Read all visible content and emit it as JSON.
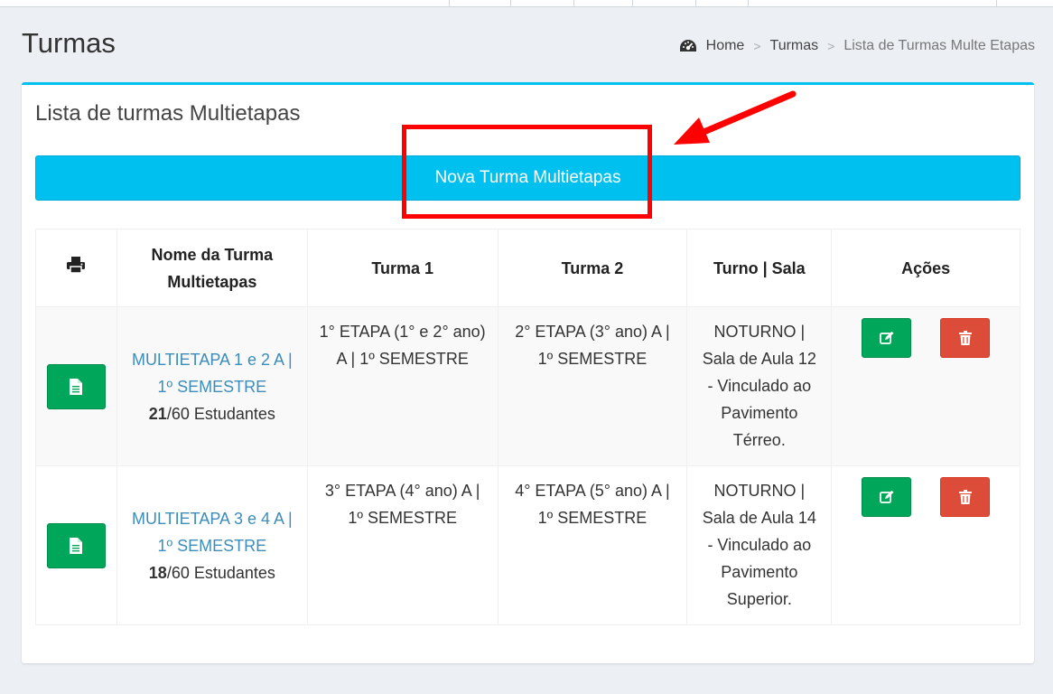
{
  "header": {
    "title": "Turmas",
    "breadcrumb": {
      "home": "Home",
      "turmas": "Turmas",
      "current": "Lista de Turmas Multe Etapas"
    }
  },
  "box": {
    "title": "Lista de turmas Multietapas",
    "new_button": "Nova Turma Multietapas"
  },
  "table": {
    "headers": {
      "name": "Nome da Turma Multietapas",
      "turma1": "Turma 1",
      "turma2": "Turma 2",
      "turno_sala": "Turno | Sala",
      "acoes": "Ações"
    },
    "rows": [
      {
        "name": "MULTIETAPA 1 e 2 A | 1º SEMESTRE",
        "count": "21",
        "capacity": "/60 Estudantes",
        "turma1": "1° ETAPA (1° e 2° ano) A | 1º SEMESTRE",
        "turma2": "2° ETAPA (3° ano) A | 1º SEMESTRE",
        "turno_sala": "NOTURNO | Sala de Aula 12 - Vinculado ao Pavimento Térreo."
      },
      {
        "name": "MULTIETAPA 3 e 4 A | 1º SEMESTRE",
        "count": "18",
        "capacity": "/60 Estudantes",
        "turma1": "3° ETAPA (4° ano) A | 1º SEMESTRE",
        "turma2": "4° ETAPA (5° ano) A | 1º SEMESTRE",
        "turno_sala": "NOTURNO | Sala de Aula 14 - Vinculado ao Pavimento Superior."
      }
    ]
  },
  "icons": {
    "breadcrumb_home": "dashboard-icon",
    "print": "print-icon",
    "document": "file-text-icon",
    "edit": "edit-icon",
    "delete": "trash-icon"
  },
  "colors": {
    "primary": "#00c0ef",
    "success": "#00a65a",
    "danger": "#dd4b39",
    "link": "#3c8dbc",
    "annotation": "#ff0000"
  }
}
